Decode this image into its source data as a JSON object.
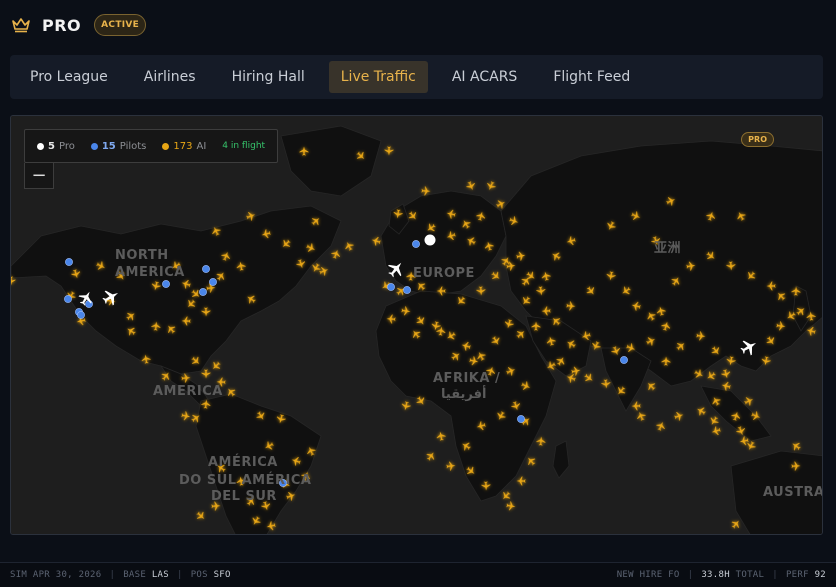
{
  "header": {
    "brand": "PRO",
    "status_badge": "ACTIVE"
  },
  "tabs": [
    {
      "label": "Pro League",
      "active": false
    },
    {
      "label": "Airlines",
      "active": false
    },
    {
      "label": "Hiring Hall",
      "active": false
    },
    {
      "label": "Live Traffic",
      "active": true
    },
    {
      "label": "AI ACARS",
      "active": false
    },
    {
      "label": "Flight Feed",
      "active": false
    }
  ],
  "map": {
    "legend": {
      "pro_count": "5",
      "pro_label": "Pro",
      "pilots_count": "15",
      "pilots_label": "Pilots",
      "ai_count": "173",
      "ai_label": "AI",
      "in_flight": "4 in flight"
    },
    "zoom_out": "−",
    "pro_chip": "PRO",
    "labels": {
      "north_america_1": "NORTH",
      "north_america_2": "AMERICA",
      "america": "AMERICA",
      "south_america_1": "AMÉRICA",
      "south_america_2": "DO SUL AMÉRICA",
      "south_america_3": "DEL SUR",
      "europe": "EUROPE",
      "africa_1": "AFRIKA /",
      "africa_2": "أفريقيا",
      "asia": "亚洲",
      "australia": "AUSTRA"
    },
    "colors": {
      "ai": "#e8a615",
      "pilot": "#4a86ea",
      "pro": "#ffffff",
      "land": "#101010",
      "water": "#1e1e1e"
    }
  },
  "footer": {
    "sim_label": "SIM",
    "sim_date": "APR 30, 2026",
    "base_label": "BASE",
    "base_value": "LAS",
    "pos_label": "POS",
    "pos_value": "SFO",
    "rank": "NEW HIRE FO",
    "hours_value": "33.8H",
    "hours_label": "TOTAL",
    "perf_label": "PERF",
    "perf_value": "92"
  }
}
